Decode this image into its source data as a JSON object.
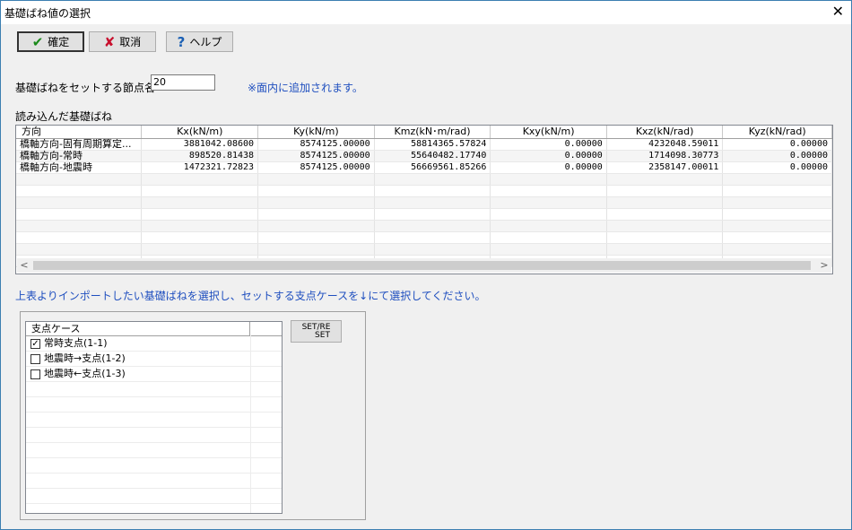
{
  "window": {
    "title": "基礎ばね値の選択",
    "close_symbol": "✕"
  },
  "toolbar": {
    "ok_label": "確定",
    "ok_icon": "✔",
    "cancel_label": "取消",
    "cancel_icon": "✘",
    "help_label": "ヘルプ",
    "help_icon": "?"
  },
  "node": {
    "label": "基礎ばねをセットする節点名",
    "value": "20",
    "note": "※面内に追加されます。"
  },
  "spring_table": {
    "caption": "読み込んだ基礎ばね",
    "columns": [
      "方向",
      "Kx(kN/m)",
      "Ky(kN/m)",
      "Kmz(kN･m/rad)",
      "Kxy(kN/m)",
      "Kxz(kN/rad)",
      "Kyz(kN/rad)"
    ],
    "rows": [
      [
        "橋軸方向-固有周期算定...",
        "3881042.08600",
        "8574125.00000",
        "58814365.57824",
        "0.00000",
        "4232048.59011",
        "0.00000"
      ],
      [
        "橋軸方向-常時",
        "898520.81438",
        "8574125.00000",
        "55640482.17740",
        "0.00000",
        "1714098.30773",
        "0.00000"
      ],
      [
        "橋軸方向-地震時",
        "1472321.72823",
        "8574125.00000",
        "56669561.85266",
        "0.00000",
        "2358147.00011",
        "0.00000"
      ]
    ],
    "scroll_left": "<",
    "scroll_right": ">"
  },
  "instruction": "上表よりインポートしたい基礎ばねを選択し、セットする支点ケースを↓にて選択してください。",
  "support_cases": {
    "header": "支点ケース",
    "items": [
      {
        "label": "常時支点(1-1)",
        "checked": true,
        "mark": "✓"
      },
      {
        "label": "地震時→支点(1-2)",
        "checked": false,
        "mark": ""
      },
      {
        "label": "地震時←支点(1-3)",
        "checked": false,
        "mark": ""
      }
    ],
    "set_reset_top": "SET/RE",
    "set_reset_bottom": "SET"
  },
  "colors": {
    "note_blue": "#1f4fbf",
    "ok_green": "#1a8a1a",
    "cancel_red": "#c8102e",
    "help_blue": "#1a5fb4"
  }
}
